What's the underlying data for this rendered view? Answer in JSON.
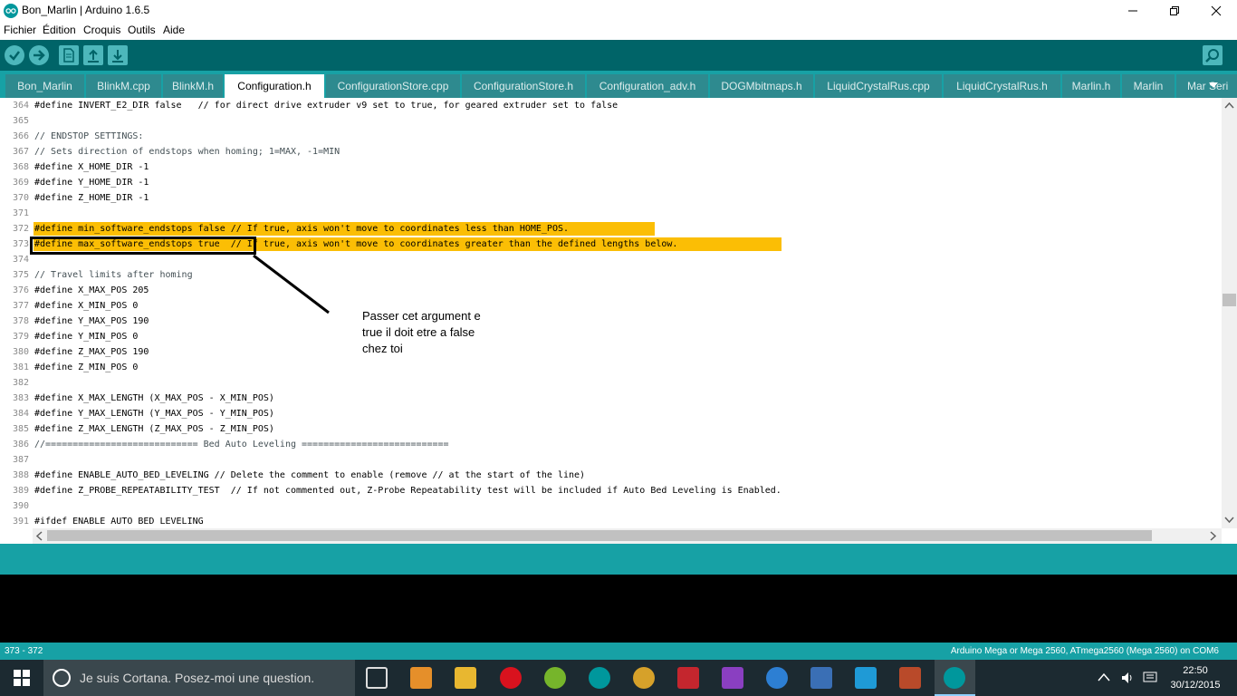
{
  "window": {
    "title": "Bon_Marlin | Arduino 1.6.5"
  },
  "menu": {
    "items": [
      "Fichier",
      "Édition",
      "Croquis",
      "Outils",
      "Aide"
    ]
  },
  "toolbar": {
    "buttons": [
      "verify-icon",
      "upload-icon",
      "new-icon",
      "open-icon",
      "save-icon",
      "serial-monitor-icon"
    ]
  },
  "tabs": [
    {
      "label": "Bon_Marlin"
    },
    {
      "label": "BlinkM.cpp"
    },
    {
      "label": "BlinkM.h"
    },
    {
      "label": "Configuration.h",
      "active": true
    },
    {
      "label": "ConfigurationStore.cpp"
    },
    {
      "label": "ConfigurationStore.h"
    },
    {
      "label": "Configuration_adv.h"
    },
    {
      "label": "DOGMbitmaps.h"
    },
    {
      "label": "LiquidCrystalRus.cpp"
    },
    {
      "label": "LiquidCrystalRus.h"
    },
    {
      "label": "Marlin.h"
    },
    {
      "label": "Marlin"
    },
    {
      "label": "Mar Seri"
    }
  ],
  "editor": {
    "lines": [
      {
        "n": "364",
        "text": "#define INVERT_E2_DIR false   // for direct drive extruder v9 set to true, for geared extruder set to false"
      },
      {
        "n": "365",
        "text": ""
      },
      {
        "n": "366",
        "text": "// ENDSTOP SETTINGS:"
      },
      {
        "n": "367",
        "text": "// Sets direction of endstops when homing; 1=MAX, -1=MIN"
      },
      {
        "n": "368",
        "text": "#define X_HOME_DIR -1"
      },
      {
        "n": "369",
        "text": "#define Y_HOME_DIR -1"
      },
      {
        "n": "370",
        "text": "#define Z_HOME_DIR -1"
      },
      {
        "n": "371",
        "text": ""
      },
      {
        "n": "372",
        "text": "#define min_software_endstops false // If true, axis won't move to coordinates less than HOME_POS."
      },
      {
        "n": "373",
        "text": "#define max_software_endstops true  // If true, axis won't move to coordinates greater than the defined lengths below."
      },
      {
        "n": "374",
        "text": ""
      },
      {
        "n": "375",
        "text": "// Travel limits after homing"
      },
      {
        "n": "376",
        "text": "#define X_MAX_POS 205"
      },
      {
        "n": "377",
        "text": "#define X_MIN_POS 0"
      },
      {
        "n": "378",
        "text": "#define Y_MAX_POS 190"
      },
      {
        "n": "379",
        "text": "#define Y_MIN_POS 0"
      },
      {
        "n": "380",
        "text": "#define Z_MAX_POS 190"
      },
      {
        "n": "381",
        "text": "#define Z_MIN_POS 0"
      },
      {
        "n": "382",
        "text": ""
      },
      {
        "n": "383",
        "text": "#define X_MAX_LENGTH (X_MAX_POS - X_MIN_POS)"
      },
      {
        "n": "384",
        "text": "#define Y_MAX_LENGTH (Y_MAX_POS - Y_MIN_POS)"
      },
      {
        "n": "385",
        "text": "#define Z_MAX_LENGTH (Z_MAX_POS - Z_MIN_POS)"
      },
      {
        "n": "386",
        "text": "//============================ Bed Auto Leveling ==========================="
      },
      {
        "n": "387",
        "text": ""
      },
      {
        "n": "388",
        "text": "#define ENABLE_AUTO_BED_LEVELING // Delete the comment to enable (remove // at the start of the line)"
      },
      {
        "n": "389",
        "text": "#define Z_PROBE_REPEATABILITY_TEST  // If not commented out, Z-Probe Repeatability test will be included if Auto Bed Leveling is Enabled."
      },
      {
        "n": "390",
        "text": ""
      },
      {
        "n": "391",
        "text": "#ifdef ENABLE AUTO BED LEVELING"
      }
    ]
  },
  "annotation": {
    "lines": [
      "Passer cet argument e",
      "true il doit etre a false",
      "chez toi"
    ]
  },
  "status": {
    "cursor": "373 - 372",
    "board": "Arduino Mega or Mega 2560, ATmega2560 (Mega 2560) on COM6"
  },
  "taskbar": {
    "search_placeholder": "Je suis Cortana. Posez-moi une question.",
    "time": "22:50",
    "date": "30/12/2015"
  },
  "colors": {
    "teal_dark": "#006468",
    "teal": "#17a1a5",
    "highlight": "#fbbe05"
  }
}
